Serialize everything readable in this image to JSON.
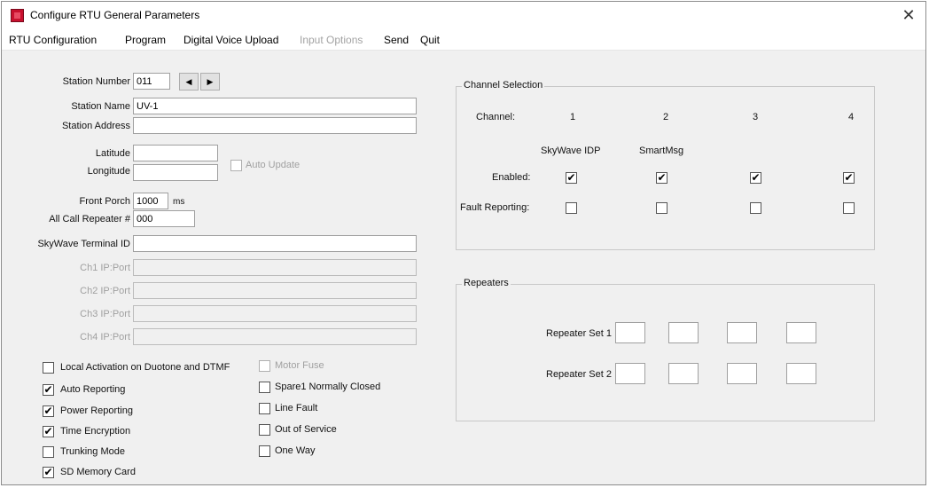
{
  "window": {
    "title": "Configure RTU General Parameters",
    "close_glyph": "✕",
    "icon": "app-icon"
  },
  "menu": [
    {
      "label": "RTU Configuration",
      "enabled": true
    },
    {
      "label": "Program",
      "enabled": true
    },
    {
      "label": "Digital Voice Upload",
      "enabled": true
    },
    {
      "label": "Input Options",
      "enabled": false
    },
    {
      "label": "Send",
      "enabled": true
    },
    {
      "label": "Quit",
      "enabled": true
    }
  ],
  "form": {
    "station_number": {
      "label": "Station Number",
      "value": "011"
    },
    "nav": {
      "prev": "◀",
      "next": "▶"
    },
    "station_name": {
      "label": "Station Name",
      "value": "UV-1"
    },
    "station_address": {
      "label": "Station Address",
      "value": ""
    },
    "latitude": {
      "label": "Latitude",
      "value": ""
    },
    "longitude": {
      "label": "Longitude",
      "value": ""
    },
    "auto_update": {
      "label": "Auto Update",
      "checked": false,
      "enabled": false
    },
    "front_porch": {
      "label": "Front Porch",
      "value": "1000",
      "unit": "ms"
    },
    "all_call_repeater": {
      "label": "All Call Repeater #",
      "value": "000"
    },
    "skywave_terminal_id": {
      "label": "SkyWave Terminal ID",
      "value": ""
    },
    "ip_ports": [
      {
        "label": "Ch1 IP:Port",
        "value": ""
      },
      {
        "label": "Ch2 IP:Port",
        "value": ""
      },
      {
        "label": "Ch3 IP:Port",
        "value": ""
      },
      {
        "label": "Ch4 IP:Port",
        "value": ""
      }
    ]
  },
  "options_left": [
    {
      "label": "Local Activation on Duotone and DTMF",
      "checked": false,
      "enabled": true
    },
    {
      "label": "Auto Reporting",
      "checked": true,
      "enabled": true
    },
    {
      "label": "Power Reporting",
      "checked": true,
      "enabled": true
    },
    {
      "label": "Time Encryption",
      "checked": true,
      "enabled": true
    },
    {
      "label": "Trunking Mode",
      "checked": false,
      "enabled": true
    },
    {
      "label": "SD Memory Card",
      "checked": true,
      "enabled": true
    }
  ],
  "options_right": [
    {
      "label": "Motor Fuse",
      "checked": false,
      "enabled": false
    },
    {
      "label": "Spare1 Normally Closed",
      "checked": false,
      "enabled": true
    },
    {
      "label": "Line Fault",
      "checked": false,
      "enabled": true
    },
    {
      "label": "Out of Service",
      "checked": false,
      "enabled": true
    },
    {
      "label": "One Way",
      "checked": false,
      "enabled": true
    }
  ],
  "channel_selection": {
    "title": "Channel Selection",
    "channel_label": "Channel:",
    "channels": [
      "1",
      "2",
      "3",
      "4"
    ],
    "types": [
      "SkyWave IDP",
      "SmartMsg",
      "",
      ""
    ],
    "enabled_label": "Enabled:",
    "enabled": [
      true,
      true,
      true,
      true
    ],
    "fault_label": "Fault Reporting:",
    "fault": [
      false,
      false,
      false,
      false
    ]
  },
  "repeaters": {
    "title": "Repeaters",
    "sets": [
      {
        "label": "Repeater Set 1",
        "values": [
          "",
          "",
          "",
          ""
        ]
      },
      {
        "label": "Repeater Set 2",
        "values": [
          "",
          "",
          "",
          ""
        ]
      }
    ]
  },
  "check_glyph": "✔"
}
